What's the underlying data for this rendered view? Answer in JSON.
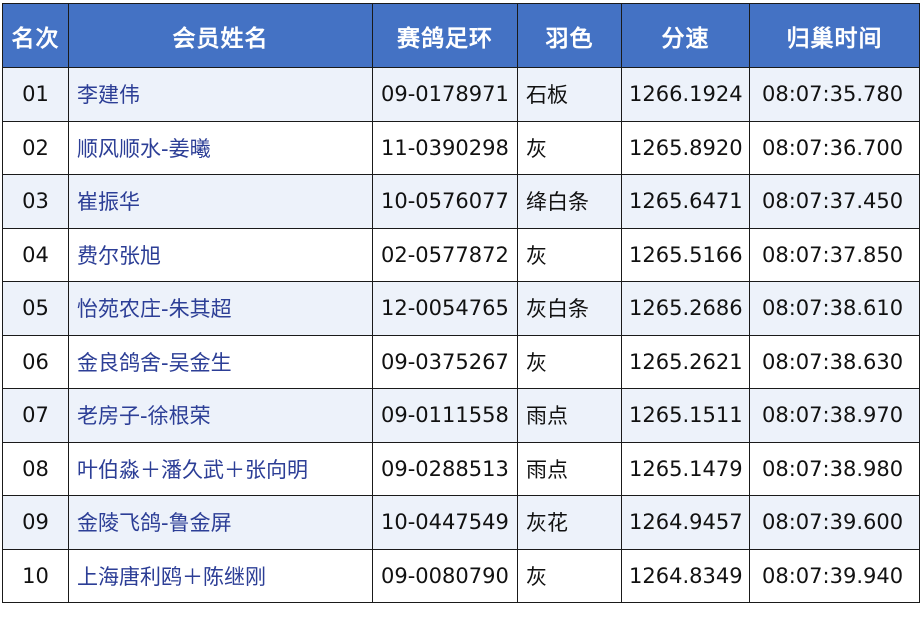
{
  "headers": {
    "rank": "名次",
    "member": "会员姓名",
    "ring": "赛鸽足环",
    "feather": "羽色",
    "speed": "分速",
    "arrival": "归巢时间"
  },
  "rows": [
    {
      "rank": "01",
      "member": "李建伟",
      "ring": "09-0178971",
      "feather": "石板",
      "speed": "1266.1924",
      "arrival": "08:07:35.780"
    },
    {
      "rank": "02",
      "member": "顺风顺水-姜曦",
      "ring": "11-0390298",
      "feather": "灰",
      "speed": "1265.8920",
      "arrival": "08:07:36.700"
    },
    {
      "rank": "03",
      "member": "崔振华",
      "ring": "10-0576077",
      "feather": "绛白条",
      "speed": "1265.6471",
      "arrival": "08:07:37.450"
    },
    {
      "rank": "04",
      "member": "费尔张旭",
      "ring": "02-0577872",
      "feather": "灰",
      "speed": "1265.5166",
      "arrival": "08:07:37.850"
    },
    {
      "rank": "05",
      "member": "怡苑农庄-朱其超",
      "ring": "12-0054765",
      "feather": "灰白条",
      "speed": "1265.2686",
      "arrival": "08:07:38.610"
    },
    {
      "rank": "06",
      "member": "金良鸽舍-吴金生",
      "ring": "09-0375267",
      "feather": "灰",
      "speed": "1265.2621",
      "arrival": "08:07:38.630"
    },
    {
      "rank": "07",
      "member": "老房子-徐根荣",
      "ring": "09-0111558",
      "feather": "雨点",
      "speed": "1265.1511",
      "arrival": "08:07:38.970"
    },
    {
      "rank": "08",
      "member": "叶伯淼＋潘久武＋张向明",
      "ring": "09-0288513",
      "feather": "雨点",
      "speed": "1265.1479",
      "arrival": "08:07:38.980"
    },
    {
      "rank": "09",
      "member": "金陵飞鸽-鲁金屏",
      "ring": "10-0447549",
      "feather": "灰花",
      "speed": "1264.9457",
      "arrival": "08:07:39.600"
    },
    {
      "rank": "10",
      "member": "上海唐利鸥＋陈继刚",
      "ring": "09-0080790",
      "feather": "灰",
      "speed": "1264.8349",
      "arrival": "08:07:39.940"
    }
  ]
}
